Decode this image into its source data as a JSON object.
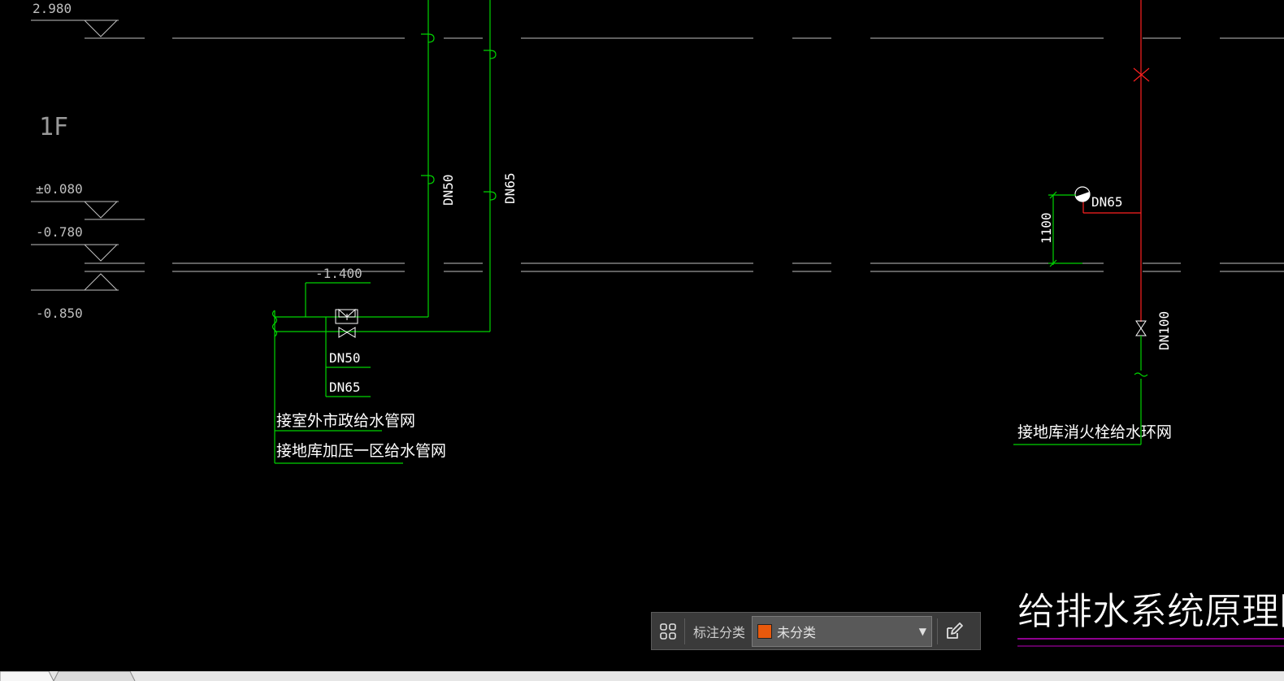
{
  "drawing": {
    "floor_label": "1F",
    "levels": {
      "top": "2.980",
      "zero": "±0.080",
      "minus_078": "-0.780",
      "minus_085": "-0.850",
      "minus_14": "-1.400"
    },
    "pipe_sizes": {
      "riser_a": "DN50",
      "riser_b": "DN65",
      "branch_a": "DN50",
      "branch_b": "DN65",
      "hydrant": "DN65",
      "fire_main": "DN100",
      "hydrant_height": "1100"
    },
    "notes": {
      "municipal": "接室外市政给水管网",
      "pressurized": "接地库加压一区给水管网",
      "fire_ring": "接地库消火栓给水环网"
    },
    "title": "给排水系统原理图",
    "colors": {
      "background": "#000000",
      "line_grey": "#bfbfbf",
      "pipe_green": "#00d400",
      "fire_red": "#ff0000",
      "title_line": "#c000c0"
    }
  },
  "toolbar": {
    "grid_icon": "grid-icon",
    "label": "标注分类",
    "select_value": "未分类",
    "swatch_color": "#e8590c",
    "arrow": "▼",
    "edit_icon": "edit-icon"
  }
}
